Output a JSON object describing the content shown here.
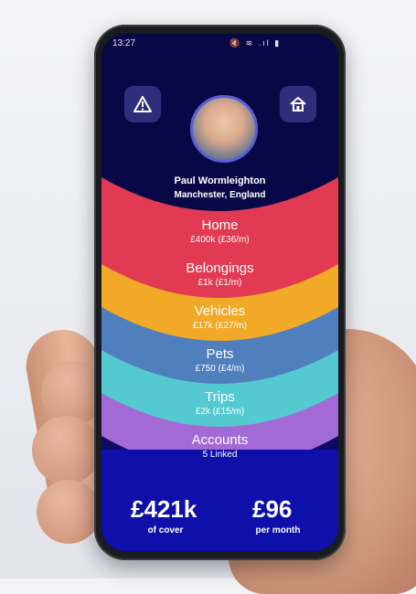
{
  "status": {
    "time": "13:27",
    "icons": "🔇 ≋ .ıl ▮"
  },
  "profile": {
    "name": "Paul Wormleighton",
    "location": "Manchester, England"
  },
  "categories": [
    {
      "label": "Home",
      "value": "£400k (£36/m)",
      "color": "#e13a52"
    },
    {
      "label": "Belongings",
      "value": "£1k (£1/m)",
      "color": "#f2a928"
    },
    {
      "label": "Vehicles",
      "value": "£17k (£27/m)",
      "color": "#4f7fbd"
    },
    {
      "label": "Pets",
      "value": "£750 (£4/m)",
      "color": "#54c9cf"
    },
    {
      "label": "Trips",
      "value": "£2k (£15/m)",
      "color": "#a36ad6"
    },
    {
      "label": "Accounts",
      "value": "5 Linked",
      "color": "#0d0c62"
    }
  ],
  "summary": {
    "cover_value": "£421k",
    "cover_label": "of cover",
    "monthly_value": "£96",
    "monthly_label": "per month"
  },
  "icons": {
    "alert": "warning-triangle-icon",
    "home": "home-icon"
  }
}
